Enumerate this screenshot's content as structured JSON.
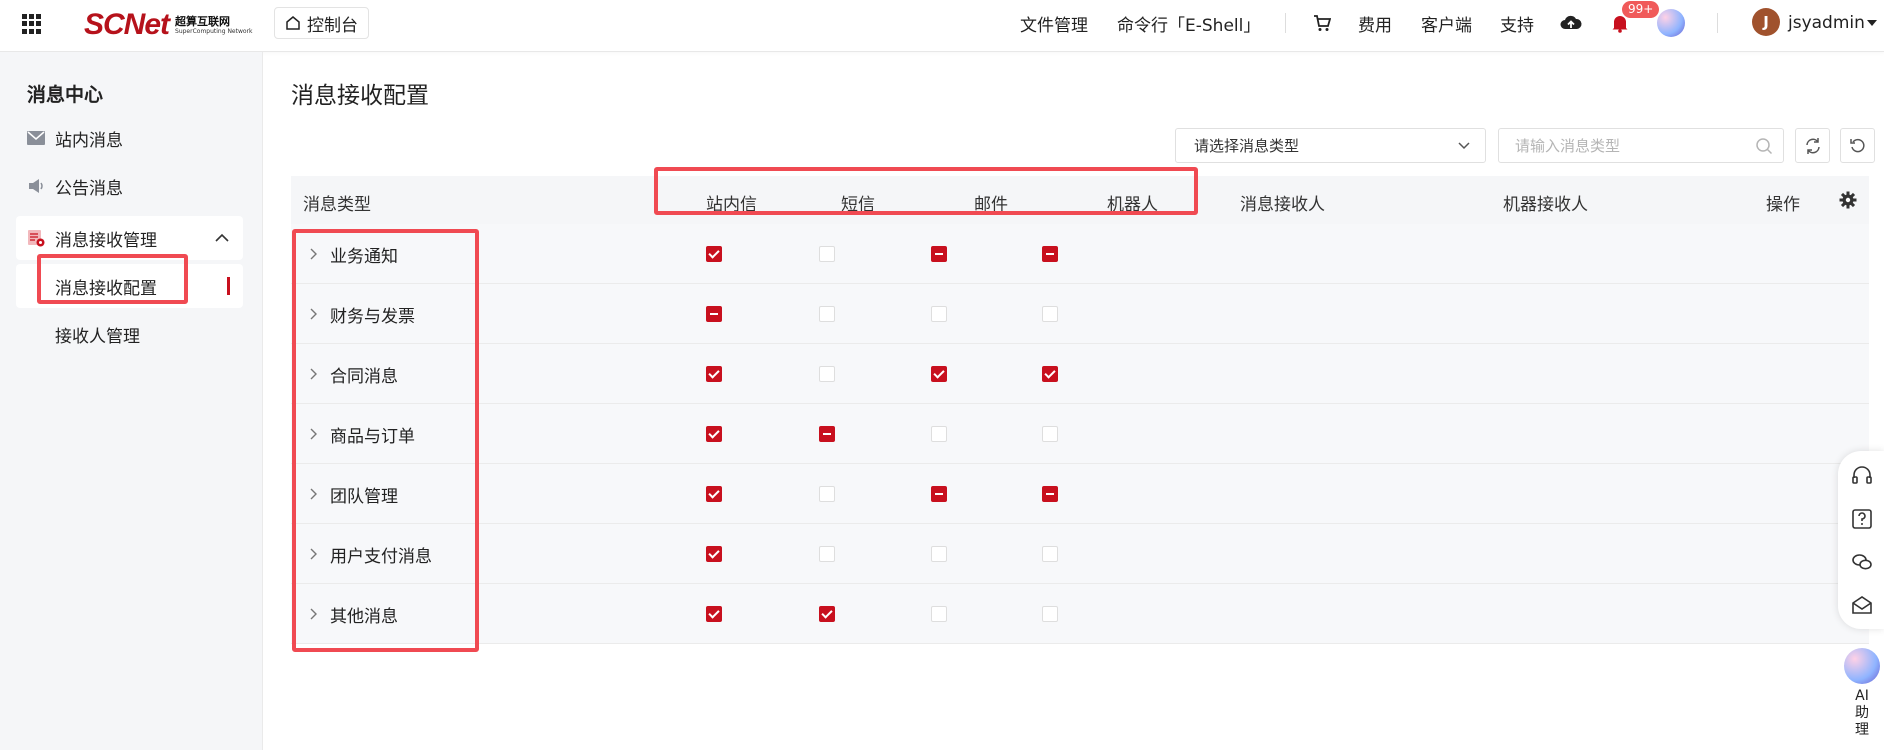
{
  "topbar": {
    "logo_main": "SCNet",
    "logo_cn": "超算互联网",
    "logo_en": "SuperComputing Network",
    "console_label": "控制台",
    "nav": [
      "文件管理",
      "命令行「E-Shell」",
      "费用",
      "客户端",
      "支持"
    ],
    "notification_badge": "99+",
    "user_initial": "J",
    "username": "jsyadmin"
  },
  "sidebar": {
    "title": "消息中心",
    "items": [
      {
        "label": "站内消息",
        "icon": "mail-icon"
      },
      {
        "label": "公告消息",
        "icon": "megaphone-icon"
      },
      {
        "label": "消息接收管理",
        "icon": "settings-doc-icon",
        "expanded": true
      }
    ],
    "sub_items": [
      {
        "label": "消息接收配置",
        "active": true
      },
      {
        "label": "接收人管理",
        "active": false
      }
    ]
  },
  "main": {
    "title": "消息接收配置",
    "select_placeholder": "请选择消息类型",
    "search_placeholder": "请输入消息类型",
    "columns": [
      "消息类型",
      "站内信",
      "短信",
      "邮件",
      "机器人",
      "消息接收人",
      "机器接收人",
      "操作"
    ],
    "rows": [
      {
        "label": "业务通知",
        "states": [
          "checked",
          "empty",
          "partial",
          "partial"
        ]
      },
      {
        "label": "财务与发票",
        "states": [
          "partial",
          "empty",
          "empty",
          "empty"
        ]
      },
      {
        "label": "合同消息",
        "states": [
          "checked",
          "empty",
          "checked",
          "checked"
        ]
      },
      {
        "label": "商品与订单",
        "states": [
          "checked",
          "partial",
          "empty",
          "empty"
        ]
      },
      {
        "label": "团队管理",
        "states": [
          "checked",
          "empty",
          "partial",
          "partial"
        ]
      },
      {
        "label": "用户支付消息",
        "states": [
          "checked",
          "empty",
          "empty",
          "empty"
        ]
      },
      {
        "label": "其他消息",
        "states": [
          "checked",
          "checked",
          "empty",
          "empty"
        ]
      }
    ]
  },
  "float_bar": {
    "icons": [
      "headset-icon",
      "help-icon",
      "wechat-icon",
      "mail-open-icon"
    ],
    "ai_label": "AI助理"
  },
  "colors": {
    "brand_red": "#c8101e",
    "highlight_red": "#f04a52"
  }
}
